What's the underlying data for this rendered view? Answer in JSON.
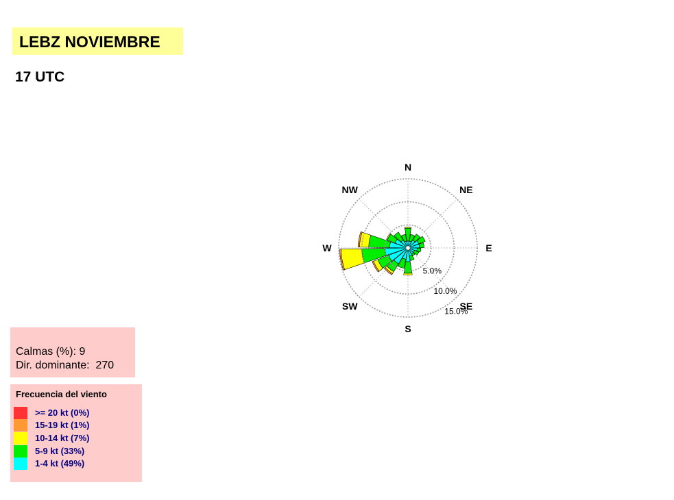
{
  "header": {
    "title": "LEBZ NOVIEMBRE",
    "subtitle": "17 UTC"
  },
  "stats": {
    "calms": "Calmas (%): 9",
    "dominant": "Dir. dominante:  270"
  },
  "legend": {
    "title": "Frecuencia del viento",
    "items": [
      {
        "label": ">= 20 kt (0%)",
        "color": "#ff3333"
      },
      {
        "label": "15-19 kt (1%)",
        "color": "#ff9933"
      },
      {
        "label": "10-14 kt (7%)",
        "color": "#ffff00"
      },
      {
        "label": "5-9 kt (33%)",
        "color": "#00ee00"
      },
      {
        "label": "1-4 kt (49%)",
        "color": "#00ffff"
      }
    ]
  },
  "chart_data": {
    "type": "wind-rose",
    "direction_labels": [
      "N",
      "NE",
      "E",
      "SE",
      "S",
      "SW",
      "W",
      "NW"
    ],
    "ring_labels": [
      "5.0%",
      "10.0%",
      "15.0%"
    ],
    "rings": [
      5,
      10,
      15
    ],
    "r_max": 15,
    "speed_classes": [
      "1-4 kt",
      "5-9 kt",
      "10-14 kt",
      "15-19 kt",
      ">= 20 kt"
    ],
    "colors": [
      "#00ffff",
      "#00ee00",
      "#ffff00",
      "#ff9933",
      "#ff3333"
    ],
    "sectors": [
      {
        "dir": 0,
        "values": [
          1.5,
          2.8,
          0.2,
          0,
          0
        ]
      },
      {
        "dir": 20,
        "values": [
          1.5,
          1.5,
          0,
          0,
          0
        ]
      },
      {
        "dir": 40,
        "values": [
          2.0,
          1.5,
          0,
          0,
          0
        ]
      },
      {
        "dir": 60,
        "values": [
          2.5,
          1.5,
          0,
          0,
          0
        ]
      },
      {
        "dir": 80,
        "values": [
          2.5,
          1.0,
          0,
          0,
          0
        ]
      },
      {
        "dir": 100,
        "values": [
          2.0,
          0.8,
          0,
          0,
          0
        ]
      },
      {
        "dir": 120,
        "values": [
          1.5,
          1.0,
          0,
          0,
          0
        ]
      },
      {
        "dir": 140,
        "values": [
          1.5,
          0.5,
          0,
          0,
          0
        ]
      },
      {
        "dir": 160,
        "values": [
          1.8,
          1.0,
          0,
          0,
          0
        ]
      },
      {
        "dir": 180,
        "values": [
          3.0,
          2.5,
          0.4,
          0,
          0
        ]
      },
      {
        "dir": 200,
        "values": [
          2.5,
          2.0,
          0,
          0,
          0
        ]
      },
      {
        "dir": 220,
        "values": [
          4.0,
          2.0,
          0.5,
          0.3,
          0
        ]
      },
      {
        "dir": 240,
        "values": [
          4.5,
          2.5,
          1.0,
          0.3,
          0
        ]
      },
      {
        "dir": 260,
        "values": [
          5.0,
          5.0,
          4.5,
          0.3,
          0
        ]
      },
      {
        "dir": 280,
        "values": [
          4.0,
          4.5,
          2.0,
          0.3,
          0
        ]
      },
      {
        "dir": 300,
        "values": [
          3.0,
          1.8,
          0.2,
          0,
          0
        ]
      },
      {
        "dir": 320,
        "values": [
          2.0,
          2.0,
          0,
          0,
          0
        ]
      },
      {
        "dir": 340,
        "values": [
          1.5,
          1.5,
          0,
          0,
          0
        ]
      }
    ]
  }
}
